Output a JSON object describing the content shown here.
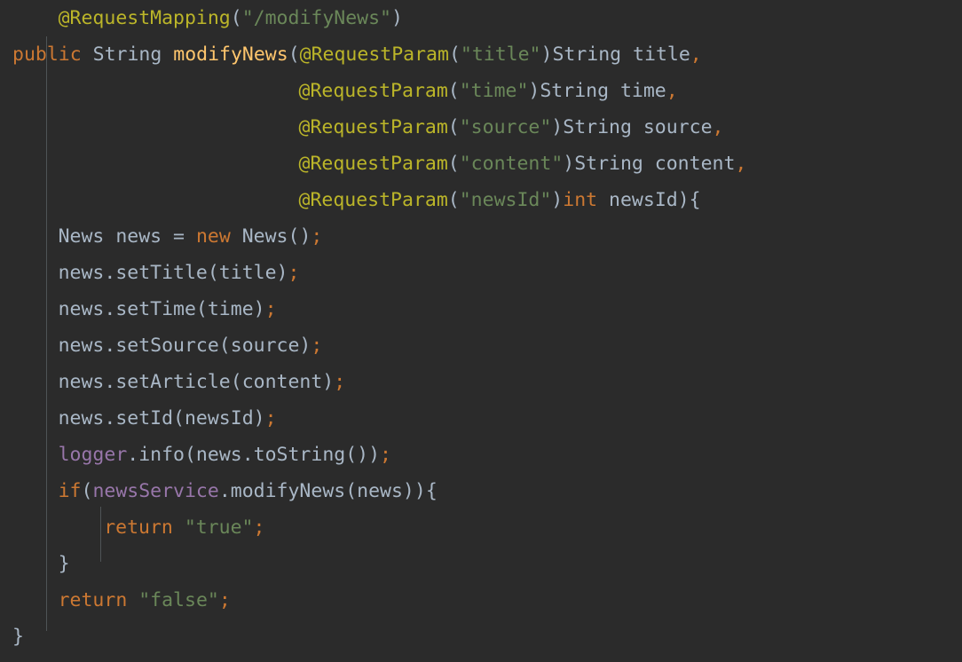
{
  "editor": {
    "language": "java",
    "theme": "darcula",
    "background_color": "#2b2b2b",
    "colors": {
      "default_text": "#a9b7c6",
      "keyword": "#cc7832",
      "annotation": "#bbb529",
      "string": "#6a8759",
      "method_declaration": "#ffc66d",
      "field": "#9876aa",
      "indent_guide": "#4f5456"
    }
  },
  "code": {
    "lines": [
      {
        "index": 0,
        "indent": 4,
        "text": "@RequestMapping(\"/modifyNews\")",
        "tokens": [
          {
            "t": "@RequestMapping",
            "c": "annotation"
          },
          {
            "t": "(",
            "c": "paren"
          },
          {
            "t": "\"/modifyNews\"",
            "c": "string"
          },
          {
            "t": ")",
            "c": "paren"
          }
        ]
      },
      {
        "index": 1,
        "indent": 0,
        "text": "public String modifyNews(@RequestParam(\"title\")String title,",
        "tokens": [
          {
            "t": "public",
            "c": "keyword"
          },
          {
            "t": " ",
            "c": "default"
          },
          {
            "t": "String",
            "c": "default"
          },
          {
            "t": " ",
            "c": "default"
          },
          {
            "t": "modifyNews",
            "c": "method"
          },
          {
            "t": "(",
            "c": "paren"
          },
          {
            "t": "@RequestParam",
            "c": "annotation"
          },
          {
            "t": "(",
            "c": "paren"
          },
          {
            "t": "\"title\"",
            "c": "string"
          },
          {
            "t": ")",
            "c": "paren"
          },
          {
            "t": "String title",
            "c": "default"
          },
          {
            "t": ",",
            "c": "punct"
          }
        ]
      },
      {
        "index": 2,
        "indent": 25,
        "text": "@RequestParam(\"time\")String time,",
        "tokens": [
          {
            "t": "@RequestParam",
            "c": "annotation"
          },
          {
            "t": "(",
            "c": "paren"
          },
          {
            "t": "\"time\"",
            "c": "string"
          },
          {
            "t": ")",
            "c": "paren"
          },
          {
            "t": "String time",
            "c": "default"
          },
          {
            "t": ",",
            "c": "punct"
          }
        ]
      },
      {
        "index": 3,
        "indent": 25,
        "text": "@RequestParam(\"source\")String source,",
        "tokens": [
          {
            "t": "@RequestParam",
            "c": "annotation"
          },
          {
            "t": "(",
            "c": "paren"
          },
          {
            "t": "\"source\"",
            "c": "string"
          },
          {
            "t": ")",
            "c": "paren"
          },
          {
            "t": "String source",
            "c": "default"
          },
          {
            "t": ",",
            "c": "punct"
          }
        ]
      },
      {
        "index": 4,
        "indent": 25,
        "text": "@RequestParam(\"content\")String content,",
        "tokens": [
          {
            "t": "@RequestParam",
            "c": "annotation"
          },
          {
            "t": "(",
            "c": "paren"
          },
          {
            "t": "\"content\"",
            "c": "string"
          },
          {
            "t": ")",
            "c": "paren"
          },
          {
            "t": "String content",
            "c": "default"
          },
          {
            "t": ",",
            "c": "punct"
          }
        ]
      },
      {
        "index": 5,
        "indent": 25,
        "text": "@RequestParam(\"newsId\")int newsId){",
        "tokens": [
          {
            "t": "@RequestParam",
            "c": "annotation"
          },
          {
            "t": "(",
            "c": "paren"
          },
          {
            "t": "\"newsId\"",
            "c": "string"
          },
          {
            "t": ")",
            "c": "paren"
          },
          {
            "t": "int",
            "c": "keyword"
          },
          {
            "t": " newsId){",
            "c": "default"
          }
        ]
      },
      {
        "index": 6,
        "indent": 4,
        "text": "News news = new News();",
        "tokens": [
          {
            "t": "News news = ",
            "c": "default"
          },
          {
            "t": "new",
            "c": "keyword"
          },
          {
            "t": " News()",
            "c": "default"
          },
          {
            "t": ";",
            "c": "punct"
          }
        ]
      },
      {
        "index": 7,
        "indent": 4,
        "text": "news.setTitle(title);",
        "tokens": [
          {
            "t": "news.setTitle(title)",
            "c": "default"
          },
          {
            "t": ";",
            "c": "punct"
          }
        ]
      },
      {
        "index": 8,
        "indent": 4,
        "text": "news.setTime(time);",
        "tokens": [
          {
            "t": "news.setTime(time)",
            "c": "default"
          },
          {
            "t": ";",
            "c": "punct"
          }
        ]
      },
      {
        "index": 9,
        "indent": 4,
        "text": "news.setSource(source);",
        "tokens": [
          {
            "t": "news.setSource(source)",
            "c": "default"
          },
          {
            "t": ";",
            "c": "punct"
          }
        ]
      },
      {
        "index": 10,
        "indent": 4,
        "text": "news.setArticle(content);",
        "tokens": [
          {
            "t": "news.setArticle(content)",
            "c": "default"
          },
          {
            "t": ";",
            "c": "punct"
          }
        ]
      },
      {
        "index": 11,
        "indent": 4,
        "text": "news.setId(newsId);",
        "tokens": [
          {
            "t": "news.setId(newsId)",
            "c": "default"
          },
          {
            "t": ";",
            "c": "punct"
          }
        ]
      },
      {
        "index": 12,
        "indent": 4,
        "text": "logger.info(news.toString());",
        "tokens": [
          {
            "t": "logger",
            "c": "field"
          },
          {
            "t": ".info(news.toString())",
            "c": "default"
          },
          {
            "t": ";",
            "c": "punct"
          }
        ]
      },
      {
        "index": 13,
        "indent": 4,
        "text": "if(newsService.modifyNews(news)){",
        "tokens": [
          {
            "t": "if",
            "c": "keyword"
          },
          {
            "t": "(",
            "c": "paren"
          },
          {
            "t": "newsService",
            "c": "field"
          },
          {
            "t": ".modifyNews(news)){",
            "c": "default"
          }
        ]
      },
      {
        "index": 14,
        "indent": 8,
        "text": "return \"true\";",
        "tokens": [
          {
            "t": "return",
            "c": "keyword"
          },
          {
            "t": " ",
            "c": "default"
          },
          {
            "t": "\"true\"",
            "c": "string"
          },
          {
            "t": ";",
            "c": "punct"
          }
        ]
      },
      {
        "index": 15,
        "indent": 4,
        "text": "}",
        "tokens": [
          {
            "t": "}",
            "c": "default"
          }
        ]
      },
      {
        "index": 16,
        "indent": 4,
        "text": "return \"false\";",
        "tokens": [
          {
            "t": "return",
            "c": "keyword"
          },
          {
            "t": " ",
            "c": "default"
          },
          {
            "t": "\"false\"",
            "c": "string"
          },
          {
            "t": ";",
            "c": "punct"
          }
        ]
      },
      {
        "index": 17,
        "indent": 0,
        "text": "}",
        "tokens": [
          {
            "t": "}",
            "c": "default"
          }
        ]
      }
    ]
  }
}
